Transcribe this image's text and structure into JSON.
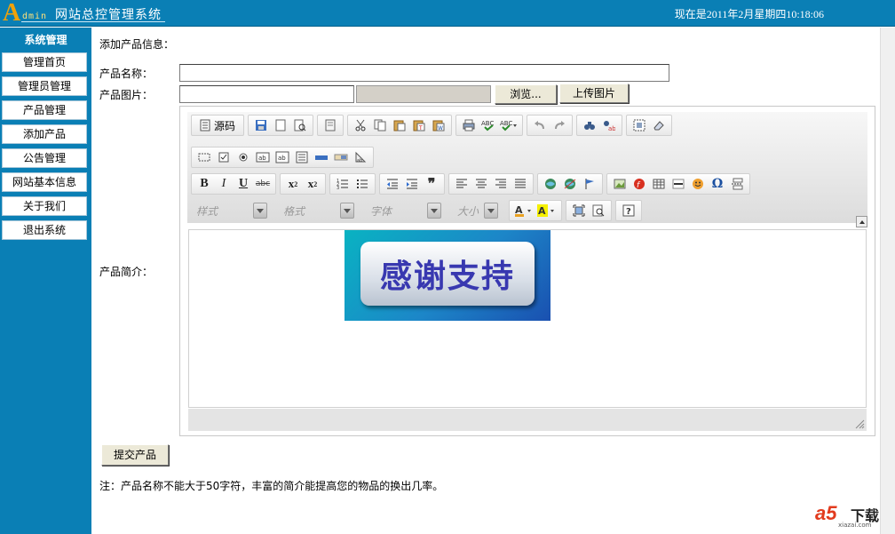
{
  "header": {
    "logo_letter": "A",
    "logo_word": "dmin",
    "title": "网站总控管理系统",
    "clock_prefix": "现在是2011年2月",
    "clock_day": "",
    "clock_suffix": "星期四10:18:06"
  },
  "sidebar": {
    "title": "系统管理",
    "items": [
      {
        "label": "管理首页"
      },
      {
        "label": "管理员管理"
      },
      {
        "label": "产品管理"
      },
      {
        "label": "添加产品"
      },
      {
        "label": "公告管理"
      },
      {
        "label": "网站基本信息"
      },
      {
        "label": "关于我们"
      },
      {
        "label": "退出系统"
      }
    ]
  },
  "form": {
    "page_title": "添加产品信息：",
    "name_label": "产品名称：",
    "name_value": "",
    "image_label": "产品图片：",
    "image_value": "",
    "browse_label": "浏览...",
    "upload_label": "上传图片",
    "desc_label": "产品简介：",
    "submit_label": "提交产品",
    "note": "注：产品名称不能大于50字符，丰富的简介能提高您的物品的换出几率。"
  },
  "editor": {
    "source_label": "源码",
    "combos": [
      {
        "label": "样式"
      },
      {
        "label": "格式"
      },
      {
        "label": "字体"
      },
      {
        "label": "大小"
      }
    ],
    "content_image_text": "感谢支持"
  },
  "watermark": {
    "brand": "a5",
    "word": "下载",
    "url": "xiazai.com"
  },
  "colors": {
    "header_bg": "#0a7fb5",
    "sidebar_bg": "#0a7fb5",
    "logo_accent": "#f0a20a",
    "clock_highlight": "#e03020"
  }
}
